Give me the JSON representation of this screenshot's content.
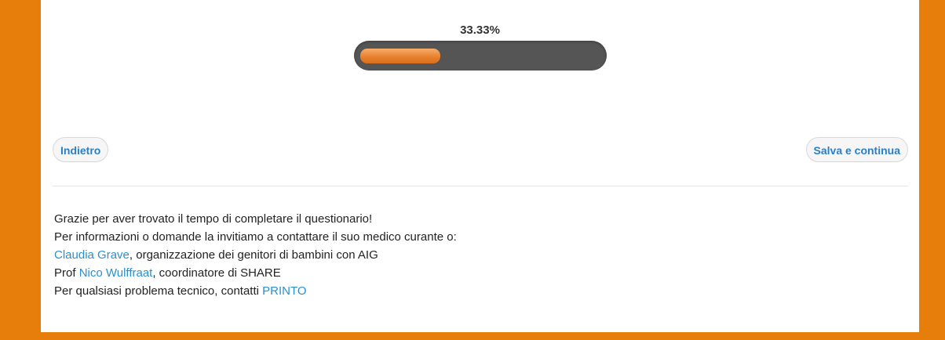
{
  "progress": {
    "label": "33.33%",
    "value_percent": 33.33
  },
  "nav": {
    "back_label": "Indietro",
    "next_label": "Salva e continua"
  },
  "info": {
    "line1": "Grazie per aver trovato il tempo di completare il questionario!",
    "line2": "Per informazioni o domande la invitiamo a contattare il suo medico curante o:",
    "line3_link": "Claudia Grave",
    "line3_text": ", organizzazione dei genitori di bambini con AIG",
    "line4_prefix": "Prof ",
    "line4_link": "Nico Wulffraat",
    "line4_text": ", coordinatore di SHARE",
    "line5_text": "Per qualsiasi problema tecnico, contatti ",
    "line5_link": "PRINTO"
  },
  "colors": {
    "background": "#e77e0c",
    "progress_fill": "#e77e2a",
    "progress_track": "#555555",
    "link": "#2a8fd0",
    "button_text": "#2a7fc7"
  }
}
